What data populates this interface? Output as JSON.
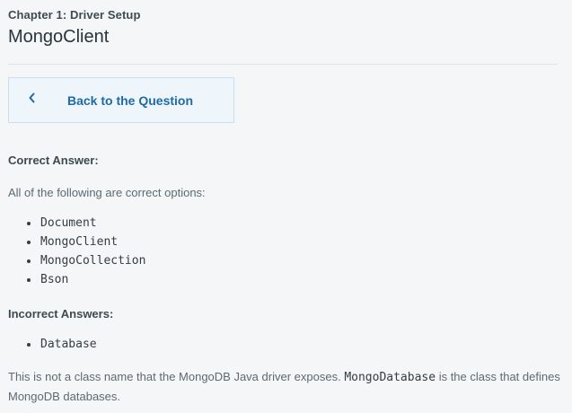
{
  "header": {
    "chapter": "Chapter 1: Driver Setup",
    "lesson_title": "MongoClient"
  },
  "back_button": {
    "label": "Back to the Question",
    "icon": "chevron-left-icon"
  },
  "correct": {
    "heading": "Correct Answer:",
    "intro": "All of the following are correct options:",
    "options": [
      "Document",
      "MongoClient",
      "MongoCollection",
      "Bson"
    ]
  },
  "incorrect": {
    "heading": "Incorrect Answers:",
    "options": [
      "Database"
    ],
    "explanation_before": "This is not a class name that the MongoDB Java driver exposes.",
    "explanation_code": "MongoDatabase",
    "explanation_after": "is the class that defines MongoDB databases."
  },
  "colors": {
    "accent": "#1e6aa6",
    "button_background": "#eef5fb",
    "button_border": "#c7dff0",
    "page_background": "#f5f6f7"
  }
}
